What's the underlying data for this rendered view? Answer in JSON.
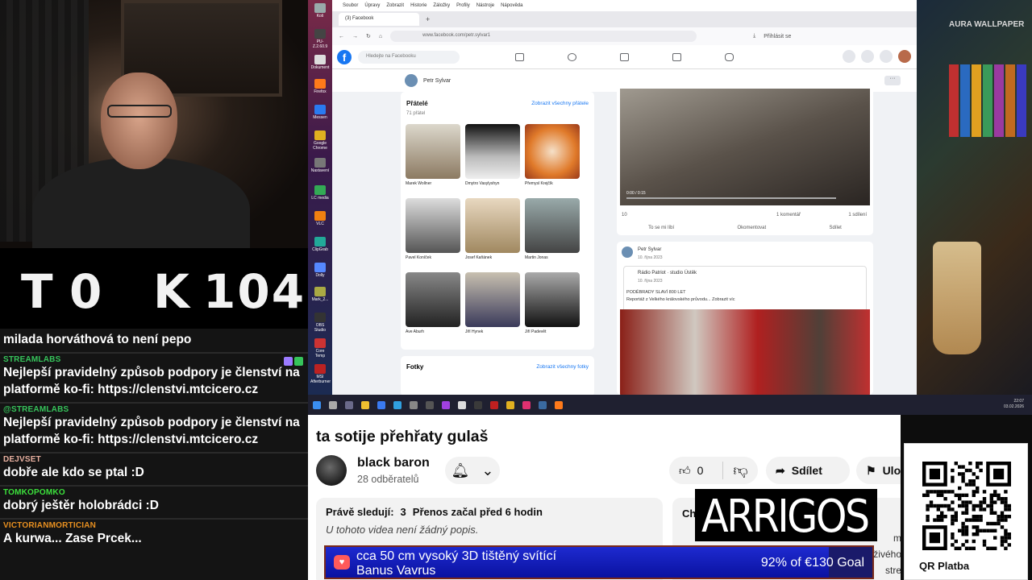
{
  "score": {
    "left_letter": "T",
    "left_value": "0",
    "right_letter": "K",
    "right_value": "104"
  },
  "chat": [
    {
      "user": "",
      "text": "milada horváthová to není pepo",
      "color": "#ffffff"
    },
    {
      "user": "STREAMLABS",
      "text": "Nejlepší pravidelný způsob podpory je členství na platformě ko-fi: https://clenstvi.mtcicero.cz",
      "color": "#36c45b"
    },
    {
      "user": "@STREAMLABS",
      "text": "Nejlepší pravidelný způsob podpory je členství na platformě ko-fi: https://clenstvi.mtcicero.cz",
      "color": "#36c45b"
    },
    {
      "user": "DEJVSET",
      "text": "dobře ale kdo se ptal :D",
      "color": "#e8b0a0"
    },
    {
      "user": "TOMKOPOMKO",
      "text": "dobrý ještěr holobrádci :D",
      "color": "#3ce03c"
    },
    {
      "user": "VICTORIANMORTICIAN",
      "text": "A kurwa... Zase Prcek...",
      "color": "#e89020"
    }
  ],
  "desktop": {
    "icons": [
      "Koš",
      "PU-Z.2.60.9",
      "Dokument",
      "Firefox",
      "Messen",
      "Google Chrome",
      "Nastavení",
      "LC media",
      "VLC",
      "ClipGrab",
      "Dolly",
      "Mark_2...",
      "OBS Studio",
      "Core Temp",
      "MSI Afterburner"
    ],
    "menubar": [
      "Soubor",
      "Úpravy",
      "Zobrazit",
      "Historie",
      "Záložky",
      "Profily",
      "Nástroje",
      "Nápověda"
    ],
    "tab_title": "(3) Facebook",
    "url": "www.facebook.com/petr.sylvar1",
    "search_placeholder": "Hledejte na Facebooku",
    "profile_name": "Petr Sylvar",
    "login": "Přihlásit se",
    "friends_title": "Přátelé",
    "friends_count": "71 přátel",
    "friends_all": "Zobrazit všechny přátele",
    "friends": [
      "Marek Wollner",
      "Dmytro Vasylyshyn",
      "Přemysl Krejčík",
      "Pavel Koníček",
      "Josef Kaňánek",
      "Martin Jonas",
      "Ave Aburh",
      "Jiří Hynek",
      "Jiří Padevět"
    ],
    "photos_title": "Fotky",
    "photos_all": "Zobrazit všechny fotky",
    "video_time": "0:00 / 0:15",
    "reactions": "10",
    "comments": "1 komentář",
    "shares": "1 sdílení",
    "like_action": "To se mi líbí",
    "comment_action": "Okomentovat",
    "share_action": "Sdílet",
    "post2_author": "Petr Sylvar",
    "post2_date": "10. října 2023",
    "post2_page": "Rádio Patriot · studio Ústěk",
    "post2_page_date": "10. října 2023",
    "post2_title": "PODĚBRADY SLAVÍ 800 LET",
    "post2_text": "Reportáž z Velkého královského průvodu... Zobrazit víc",
    "wallpaper_brand": "AURA WALLPAPER",
    "clock_time": "22:07",
    "clock_date": "03.02.2026"
  },
  "youtube": {
    "title": "ta sotije přehřaty gulaš",
    "channel": "black baron",
    "subscribers": "28 odběratelů",
    "likes": "0",
    "share": "Sdílet",
    "save": "Ulo",
    "watching_label": "Právě sledují:",
    "watching_count": "3",
    "started": "Přenos začal před 6 hodin",
    "no_description": "U tohoto videa není žádný popis.",
    "chat_label": "Ch",
    "chat_line1": "m",
    "chat_line2": "o živého",
    "chat_line3": "stre"
  },
  "sponsor_logo": "ARRIGOS",
  "goal": {
    "line1": "cca 50 cm vysoký 3D tištěný svítící",
    "line2": "Banus Vavrus",
    "progress_text": "92% of €130 Goal",
    "progress": 0.92
  },
  "qr": {
    "caption": "QR Platba"
  }
}
